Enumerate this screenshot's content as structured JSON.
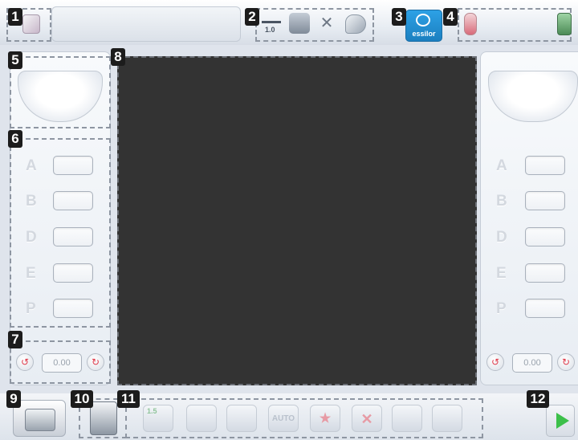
{
  "callouts": [
    "1",
    "2",
    "3",
    "4",
    "5",
    "6",
    "7",
    "8",
    "9",
    "10",
    "11",
    "12"
  ],
  "header": {
    "toolbar_small_label": "1.0",
    "brand_label": "essilor"
  },
  "shape_fields": {
    "labels": [
      "A",
      "B",
      "D",
      "E",
      "P"
    ]
  },
  "angle": {
    "left_value": "0.00",
    "right_value": "0.00"
  },
  "bottom_toolbar": {
    "num_label": "1.5",
    "auto_label": "AUTO"
  },
  "colors": {
    "screen": "#333333",
    "brand_blue": "#1b8fd6",
    "play_green": "#3cc04a",
    "dial_red": "#e03a4a"
  },
  "icons": [
    "lens-3d-icon",
    "distance-icon",
    "frame-icon",
    "tools-icon",
    "lens-shape-icon",
    "essilor-logo-icon",
    "thermometer-icon",
    "operator-icon",
    "tracer-icon",
    "edger-icon",
    "curve-icon",
    "bevel-icon",
    "groove-icon",
    "auto-bevel-icon",
    "star-icon",
    "cancel-shape-icon",
    "polish-icon",
    "chamfer-icon",
    "play-icon"
  ]
}
